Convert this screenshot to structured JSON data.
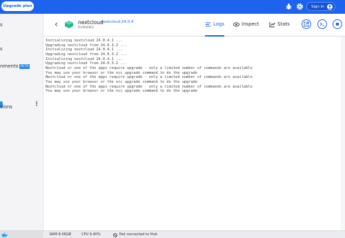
{
  "topbar": {
    "upgrade_label": "Upgrade plan",
    "signin_label": "Sign in",
    "icons": [
      "bug-icon",
      "gear-icon",
      "user-icon"
    ],
    "accent": "#1d63ed"
  },
  "sidebar": {
    "item_fragments": [
      "s",
      "s",
      "nments",
      "sions"
    ],
    "beta_label": "BETA"
  },
  "container": {
    "name": "nextcloud",
    "image": "nextcloud:24.0.4",
    "status": "RUNNING"
  },
  "tabs": [
    {
      "label": "Logs",
      "icon": "logs-icon",
      "active": true
    },
    {
      "label": "Inspect",
      "icon": "eye-icon",
      "active": false
    },
    {
      "label": "Stats",
      "icon": "chart-icon",
      "active": false
    }
  ],
  "actions": [
    "open-in-browser-icon",
    "terminal-icon",
    "stop-icon"
  ],
  "logs": [
    "Initializing nextcloud 24.0.4.1 ...",
    "Upgrading nextcloud from 24.0.3.2 ...",
    "Initializing nextcloud 24.0.4.1 ...",
    "Upgrading nextcloud from 24.0.3.2 ...",
    "Initializing nextcloud 24.0.4.1 ...",
    "Upgrading nextcloud from 24.0.3.2 ...",
    "Nextcloud or one of the apps require upgrade - only a limited number of commands are available",
    "You may use your browser or the occ upgrade command to do the upgrade",
    "Nextcloud or one of the apps require upgrade - only a limited number of commands are available",
    "You may use your browser or the occ upgrade command to do the upgrade",
    "Nextcloud or one of the apps require upgrade - only a limited number of commands are available",
    "You may use your browser or the occ upgrade command to do the upgrade"
  ],
  "footer": {
    "ram": "RAM 8.06GB",
    "cpu": "CPU 9.40%",
    "hub": "Not connected to Hub"
  }
}
